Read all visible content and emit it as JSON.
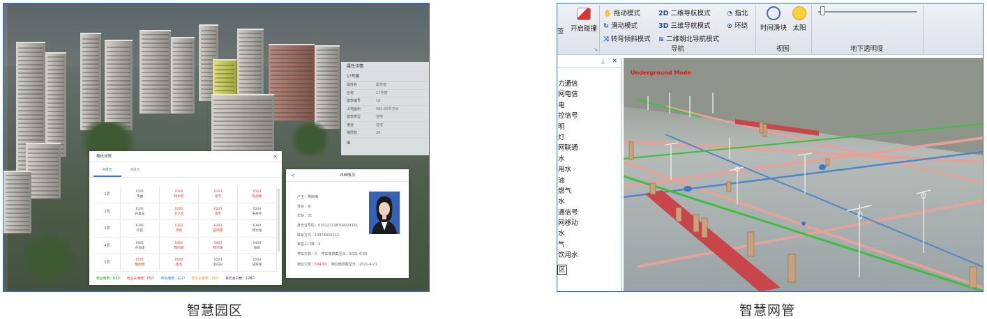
{
  "captions": {
    "left": "智慧园区",
    "right": "智慧网管"
  },
  "attr_panel": {
    "title": "属性详情",
    "building": "17号楼",
    "rows": [
      {
        "k": "属性名",
        "v": "属性值"
      },
      {
        "k": "名称",
        "v": "17号楼"
      },
      {
        "k": "建筑编号",
        "v": "18"
      },
      {
        "k": "占地面积",
        "v": "560.00平方米"
      },
      {
        "k": "建筑类型",
        "v": "住宅"
      },
      {
        "k": "用途",
        "v": "住宅"
      },
      {
        "k": "楼层数",
        "v": "26"
      }
    ]
  },
  "detail_modal": {
    "title": "楼栋详情",
    "close": "×",
    "tabs": [
      "A单元",
      "B单元"
    ],
    "floors": [
      {
        "floor": "1层",
        "units": [
          {
            "no": "0101",
            "name": "韦曲",
            "status": "normal"
          },
          {
            "no": "0102",
            "name": "杨尔恋",
            "status": "red"
          },
          {
            "no": "0103",
            "name": "张杰",
            "status": "red"
          },
          {
            "no": "0104",
            "name": "赵丽颖",
            "status": "red"
          }
        ]
      },
      {
        "floor": "2层",
        "units": [
          {
            "no": "0201",
            "name": "孙晨玉",
            "status": "normal"
          },
          {
            "no": "0202",
            "name": "卫之冰",
            "status": "red"
          },
          {
            "no": "0203",
            "name": "张芳",
            "status": "red"
          },
          {
            "no": "0204",
            "name": "朱辉平",
            "status": "normal"
          }
        ]
      },
      {
        "floor": "3层",
        "units": [
          {
            "no": "0301",
            "name": "许芸",
            "status": "normal"
          },
          {
            "no": "0302",
            "name": "洪高",
            "status": "red"
          },
          {
            "no": "0303",
            "name": "田晓寰",
            "status": "red"
          },
          {
            "no": "0304",
            "name": "韩文强",
            "status": "normal"
          }
        ]
      },
      {
        "floor": "4层",
        "units": [
          {
            "no": "0401",
            "name": "齐劲建",
            "status": "normal"
          },
          {
            "no": "0402",
            "name": "陶鸣雨",
            "status": "red"
          },
          {
            "no": "0403",
            "name": "杨杰辉",
            "status": "red"
          },
          {
            "no": "0404",
            "name": "陆莉",
            "status": "normal"
          }
        ]
      },
      {
        "floor": "5层",
        "units": [
          {
            "no": "0501",
            "name": "魏明怡",
            "status": "red"
          },
          {
            "no": "0502",
            "name": "金可",
            "status": "red"
          },
          {
            "no": "0503",
            "name": "李向兴",
            "status": "normal"
          },
          {
            "no": "0504",
            "name": "成辉辉",
            "status": "normal"
          }
        ]
      }
    ],
    "legend": [
      {
        "label": "物业缴费：",
        "value": "63户",
        "color": "#1aa31a"
      },
      {
        "label": "物业未缴费：",
        "value": "65户",
        "color": "#e03b3b"
      },
      {
        "label": "停车缴费：",
        "value": "62户",
        "color": "#2b7be0"
      },
      {
        "label": "停车未缴费：",
        "value": "66户",
        "color": "#f0a020"
      },
      {
        "label": "单元总户数：",
        "value": "128户",
        "color": "#333333"
      }
    ]
  },
  "resident_modal": {
    "title": "详细情况",
    "back": "<",
    "lines": [
      {
        "k": "户主：",
        "v": "陶雨梅",
        "red": false
      },
      {
        "k": "性别：",
        "v": "女",
        "red": false
      },
      {
        "k": "年龄：",
        "v": "31",
        "red": false
      },
      {
        "k": "身份证号码：",
        "v": "610121198304024161",
        "red": false
      },
      {
        "k": "联系方式：",
        "v": "13974820112",
        "red": false
      },
      {
        "k": "家庭人口数：",
        "v": "3",
        "red": false
      }
    ],
    "fee1": {
      "k": "停车欠费：",
      "v": "0",
      "k2": "停车缴费截至日：",
      "v2": "2021-6-20"
    },
    "fee2": {
      "k": "物业欠费：",
      "v": "534.60",
      "k2": "物业缴费截至日：",
      "v2": "2021-4-21"
    }
  },
  "ribbon": {
    "sign": "签",
    "collision": "开启碰撞",
    "modes": [
      "拖动模式",
      "滑动模式",
      "转弯倾斜模式"
    ],
    "nav_2d": "二维导航模式",
    "nav_3d": "三维导航模式",
    "nav_north": "二维朝北导航模式",
    "compass": "指北",
    "orbit": "环绕",
    "nav_group": "导航",
    "time_slider": "时间滑块",
    "sun": "太阳",
    "view_group": "视图",
    "underground_group": "地下透明度",
    "transparency": 0.02
  },
  "layers": [
    "力通信",
    "网电信",
    "电",
    "控信号",
    "明",
    "灯",
    "网联通",
    "水",
    "用水",
    "油",
    "燃气",
    "水",
    "通信号",
    "网移动",
    "水",
    "气",
    "饮用水",
    "区"
  ],
  "scene": {
    "mode_label": "Underground Mode"
  }
}
